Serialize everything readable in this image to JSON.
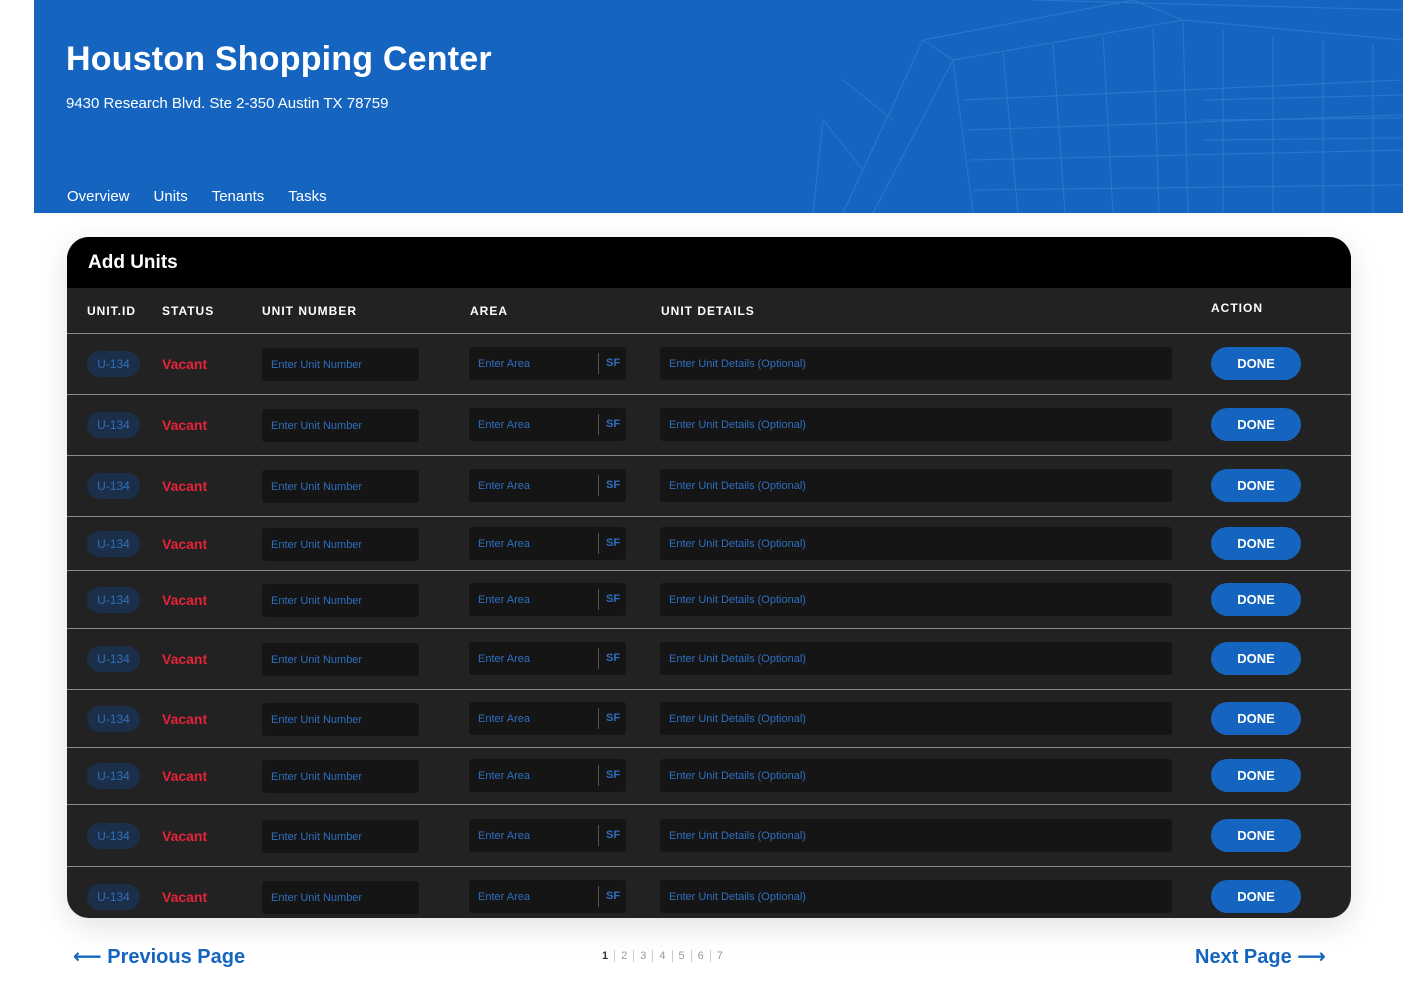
{
  "header": {
    "title": "Houston Shopping Center",
    "address": "9430 Research Blvd. Ste 2-350 Austin TX 78759",
    "tabs": [
      "Overview",
      "Units",
      "Tenants",
      "Tasks"
    ],
    "active_tab": "Units"
  },
  "card": {
    "title": "Add Units",
    "columns": {
      "unit_id": "UNIT.ID",
      "status": "STATUS",
      "unit_number": "UNIT NUMBER",
      "area": "AREA",
      "unit_details": "UNIT DETAILS",
      "action": "ACTION"
    },
    "rows": [
      {
        "unit_id": "U-134",
        "status": "Vacant",
        "unit_number_placeholder": "Enter Unit Number",
        "area_placeholder": "Enter Area",
        "area_unit": "SF",
        "details_placeholder": "Enter Unit Details (Optional)",
        "action": "DONE"
      },
      {
        "unit_id": "U-134",
        "status": "Vacant",
        "unit_number_placeholder": "Enter Unit Number",
        "area_placeholder": "Enter Area",
        "area_unit": "SF",
        "details_placeholder": "Enter Unit Details (Optional)",
        "action": "DONE"
      },
      {
        "unit_id": "U-134",
        "status": "Vacant",
        "unit_number_placeholder": "Enter Unit Number",
        "area_placeholder": "Enter Area",
        "area_unit": "SF",
        "details_placeholder": "Enter Unit Details (Optional)",
        "action": "DONE"
      },
      {
        "unit_id": "U-134",
        "status": "Vacant",
        "unit_number_placeholder": "Enter Unit Number",
        "area_placeholder": "Enter Area",
        "area_unit": "SF",
        "details_placeholder": "Enter Unit Details (Optional)",
        "action": "DONE"
      },
      {
        "unit_id": "U-134",
        "status": "Vacant",
        "unit_number_placeholder": "Enter Unit Number",
        "area_placeholder": "Enter Area",
        "area_unit": "SF",
        "details_placeholder": "Enter Unit Details (Optional)",
        "action": "DONE"
      },
      {
        "unit_id": "U-134",
        "status": "Vacant",
        "unit_number_placeholder": "Enter Unit Number",
        "area_placeholder": "Enter Area",
        "area_unit": "SF",
        "details_placeholder": "Enter Unit Details (Optional)",
        "action": "DONE"
      },
      {
        "unit_id": "U-134",
        "status": "Vacant",
        "unit_number_placeholder": "Enter Unit Number",
        "area_placeholder": "Enter Area",
        "area_unit": "SF",
        "details_placeholder": "Enter Unit Details (Optional)",
        "action": "DONE"
      },
      {
        "unit_id": "U-134",
        "status": "Vacant",
        "unit_number_placeholder": "Enter Unit Number",
        "area_placeholder": "Enter Area",
        "area_unit": "SF",
        "details_placeholder": "Enter Unit Details (Optional)",
        "action": "DONE"
      },
      {
        "unit_id": "U-134",
        "status": "Vacant",
        "unit_number_placeholder": "Enter Unit Number",
        "area_placeholder": "Enter Area",
        "area_unit": "SF",
        "details_placeholder": "Enter Unit Details (Optional)",
        "action": "DONE"
      },
      {
        "unit_id": "U-134",
        "status": "Vacant",
        "unit_number_placeholder": "Enter Unit Number",
        "area_placeholder": "Enter Area",
        "area_unit": "SF",
        "details_placeholder": "Enter Unit Details (Optional)",
        "action": "DONE"
      }
    ]
  },
  "pagination": {
    "prev_label": "⟵ Previous Page",
    "next_label": "Next Page ⟶",
    "pages": [
      "1",
      "2",
      "3",
      "4",
      "5",
      "6",
      "7"
    ],
    "current_page": "1"
  },
  "colors": {
    "brand_blue": "#1565c0",
    "status_vacant": "#e3243b",
    "tab_indicator": "#f5c518",
    "card_bg": "#222222"
  }
}
